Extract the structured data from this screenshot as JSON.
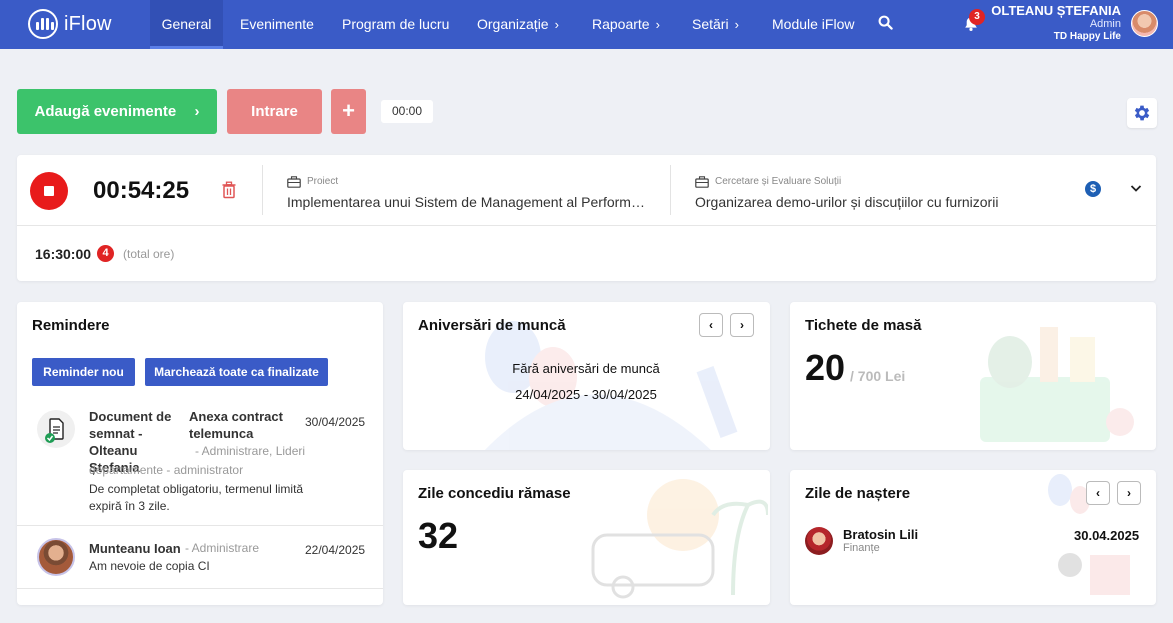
{
  "app": {
    "logo_text": "iFlow"
  },
  "nav": {
    "items": [
      {
        "label": "General",
        "active": true
      },
      {
        "label": "Evenimente"
      },
      {
        "label": "Program de lucru"
      },
      {
        "label": "Organizație",
        "chevron": true
      },
      {
        "label": "Rapoarte",
        "chevron": true
      },
      {
        "label": "Setări",
        "chevron": true
      },
      {
        "label": "Module iFlow"
      }
    ],
    "notifications_count": "3",
    "chevron_glyph": "›"
  },
  "user": {
    "name": "OLTEANU ȘTEFANIA",
    "role": "Admin",
    "company": "TD Happy Life"
  },
  "toolbar": {
    "add_events_label": "Adaugă evenimente",
    "add_events_arrow": "›",
    "entry_label": "Intrare",
    "plus_label": "+",
    "timer_value": "00:00"
  },
  "timer": {
    "elapsed": "00:54:25",
    "project_label": "Proiect",
    "project_value": "Implementarea unui Sistem de Management al Performanței",
    "activity_label": "Cercetare și Evaluare Soluții",
    "activity_value": "Organizarea demo-urilor și discuțiilor cu furnizorii",
    "currency_glyph": "$",
    "total_hours": "16:30:00",
    "entries_count": "4",
    "total_hours_label": "(total ore)"
  },
  "reminders": {
    "title": "Remindere",
    "new_button": "Reminder nou",
    "mark_all_button": "Marchează toate ca finalizate",
    "items": [
      {
        "title_left": "Document de semnat - Olteanu Ștefania",
        "title_right": "Anexa contract telemunca",
        "meta": "- Administrare, Lideri departamente - administrator",
        "body": "De completat obligatoriu, termenul limită expiră în 3 zile.",
        "date": "30/04/2025"
      },
      {
        "title_left": "Munteanu Ioan",
        "meta": "- Administrare",
        "body": "Am nevoie de copia CI",
        "date": "22/04/2025"
      }
    ]
  },
  "anniversaries": {
    "title": "Aniversări de muncă",
    "empty_text": "Fără aniversări de muncă",
    "range": "24/04/2025 - 30/04/2025",
    "prev_glyph": "‹",
    "next_glyph": "›"
  },
  "meal_tickets": {
    "title": "Tichete de masă",
    "count": "20",
    "amount": "/ 700 Lei"
  },
  "vacation": {
    "title": "Zile concediu rămase",
    "days": "32"
  },
  "birthdays": {
    "title": "Zile de naștere",
    "prev_glyph": "‹",
    "next_glyph": "›",
    "items": [
      {
        "name": "Bratosin Lili",
        "department": "Finanțe",
        "date": "30.04.2025"
      }
    ]
  },
  "colors": {
    "nav": "#3a5bc7",
    "green": "#3cc36b",
    "salmon": "#e98585",
    "stop_red": "#e81b1b",
    "blue_btn": "#3a5bc7"
  }
}
